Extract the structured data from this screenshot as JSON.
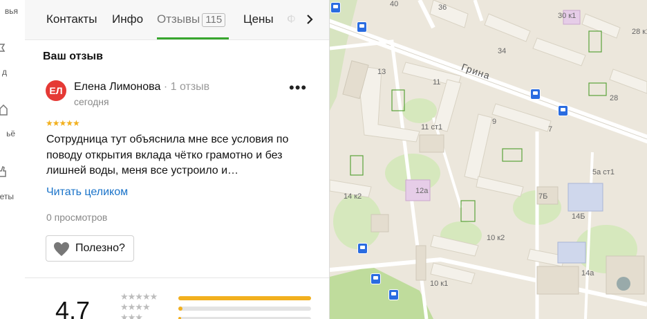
{
  "left_rail": {
    "items": [
      {
        "label": "вья",
        "icon": "document-icon"
      },
      {
        "label": "д",
        "icon": "pin-icon"
      },
      {
        "label": "ьё",
        "icon": "house-icon"
      },
      {
        "label": "еты",
        "icon": "thumb-icon"
      }
    ]
  },
  "tabs": {
    "items": [
      "Контакты",
      "Инфо",
      "Отзывы",
      "Цены",
      "Ф"
    ],
    "reviews_count": "115",
    "active": "Отзывы"
  },
  "review": {
    "section_title": "Ваш отзыв",
    "avatar_initials": "ЕЛ",
    "author": "Елена Лимонова",
    "author_meta": "· 1 отзыв",
    "date": "сегодня",
    "menu": "•••",
    "rating": 5,
    "stars": "★★★★★",
    "text": "Сотрудница тут объяснила мне все условия по поводу открытия вклада чётко грамотно и без лишней воды, меня все устроило и…",
    "read_more": "Читать целиком",
    "views": "0 просмотров",
    "useful_label": "Полезно?"
  },
  "rating_summary": {
    "value": "4,7",
    "distribution": [
      {
        "stars": "★★★★★",
        "fraction": 1.0
      },
      {
        "stars": "★★★★",
        "fraction": 0.03
      },
      {
        "stars": "★★★",
        "fraction": 0.02
      }
    ]
  },
  "map": {
    "street": "Грина",
    "colors": {
      "accent": "#37a62d",
      "bus": "#2a6ce0",
      "star": "#f2b01e",
      "link": "#1a73c9"
    },
    "labels": [
      "40",
      "36",
      "34",
      "30 к1",
      "28 к1",
      "28",
      "13",
      "11",
      "11 ст1",
      "9",
      "7",
      "5а ст1",
      "14 к2",
      "12а",
      "7Б",
      "14Б",
      "10 к2",
      "14а",
      "10 к1"
    ]
  }
}
